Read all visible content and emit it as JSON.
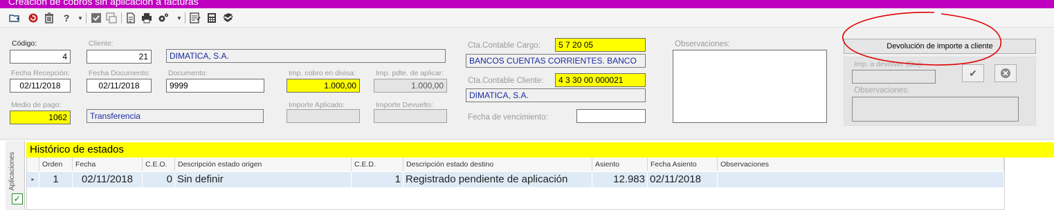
{
  "window": {
    "title": "Creación de cobros sin aplicación a facturas"
  },
  "toolbar": {
    "icons": [
      "new-folder-icon",
      "refresh-icon",
      "delete-icon",
      "help-icon",
      "dropdown-icon",
      "confirm-icon",
      "copy-window-icon",
      "document-icon",
      "print-icon",
      "settings-icon",
      "dropdown-icon",
      "list-icon",
      "calculator-icon",
      "database-icon"
    ]
  },
  "form": {
    "codigo": {
      "label": "Código:",
      "value": "4"
    },
    "cliente": {
      "label": "Cliente:",
      "value": "21",
      "name": "DIMATICA,  S.A."
    },
    "fecha_recepcion": {
      "label": "Fecha Recepción:",
      "value": "02/11/2018"
    },
    "fecha_documento": {
      "label": "Fecha Documento:",
      "value": "02/11/2018"
    },
    "documento": {
      "label": "Documento:",
      "value": "9999"
    },
    "imp_cobro_divisa": {
      "label": "Imp. cobro en divisa:",
      "value": "1.000,00"
    },
    "imp_pdte_aplicar": {
      "label": "Imp. pdte. de aplicar:",
      "value": "1.000,00"
    },
    "medio_pago": {
      "label": "Medio de pago:",
      "value": "1062",
      "name": "Transferencia"
    },
    "importe_aplicado": {
      "label": "Importe Aplicado:",
      "value": ""
    },
    "importe_devuelto": {
      "label": "Importe Devuelto:",
      "value": ""
    },
    "cta_cargo": {
      "label": "Cta.Contable Cargo:",
      "value": "5 7 20 05",
      "name": "BANCOS CUENTAS CORRIENTES. BANCO"
    },
    "cta_cliente": {
      "label": "Cta.Contable Cliente:",
      "value": "4 3 30 00 000021",
      "name": "DIMATICA,  S.A."
    },
    "fecha_vencimiento": {
      "label": "Fecha de vencimiento:",
      "value": ""
    },
    "observaciones": {
      "label": "Observaciones:",
      "value": ""
    }
  },
  "devolucion": {
    "button_label": "Devolución de importe a cliente",
    "imp_devolver_label": "Imp. a devolver (Div):",
    "imp_devolver_value": "",
    "observaciones_label": "Observaciones:",
    "observaciones_value": ""
  },
  "annotation_color": "#e00000",
  "left_tab": {
    "label": "Aplicaciones"
  },
  "historico": {
    "title": "Histórico de estados",
    "columns": [
      "Orden",
      "Fecha",
      "C.E.O.",
      "Descripción estado origen",
      "C.E.D.",
      "Descripción estado destino",
      "Asiento",
      "Fecha Asiento",
      "Observaciones"
    ],
    "rows": [
      [
        "1",
        "02/11/2018",
        "0",
        "Sin definir",
        "1",
        "Registrado pendiente de aplicación",
        "12.983",
        "02/11/2018",
        ""
      ]
    ]
  },
  "colors": {
    "title_bar": "#c000c0",
    "highlight": "#ffff00",
    "row_selected": "#deeaf6",
    "link_text": "#1a2aa0"
  }
}
